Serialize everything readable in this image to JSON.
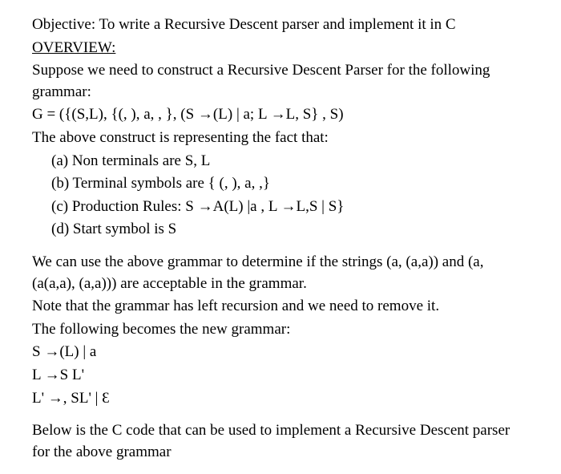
{
  "objective": "Objective: To write a Recursive Descent parser and implement it in C",
  "overview_title": "OVERVIEW:",
  "overview_intro": "Suppose we need to construct a Recursive Descent Parser for the following grammar:",
  "grammar_def": "G = ({(S,L), {(, ), a, , }, (S →(L) | a;  L →L, S} , S)",
  "grammar_fact": "The above construct is representing the fact that:",
  "items": {
    "a": "(a) Non terminals are S, L",
    "b": "(b) Terminal symbols are { (, ), a, ,}",
    "c": "(c) Production Rules: S →A(L) |a , L →L,S | S}",
    "d": "(d) Start symbol is S"
  },
  "usage_para": "We can use the above grammar to determine if the strings (a, (a,a)) and  (a, (a(a,a), (a,a))) are acceptable in the grammar.",
  "left_recursion": "Note that the grammar has left recursion and we need to remove it.",
  "new_grammar_intro": "The following becomes the new grammar:",
  "new_grammar": {
    "line1": "S →(L) | a",
    "line2": "L →S L'",
    "line3": "L' →, SL' | Ɛ"
  },
  "closing": "Below is the C code that can be used to implement a Recursive Descent parser for the above grammar"
}
